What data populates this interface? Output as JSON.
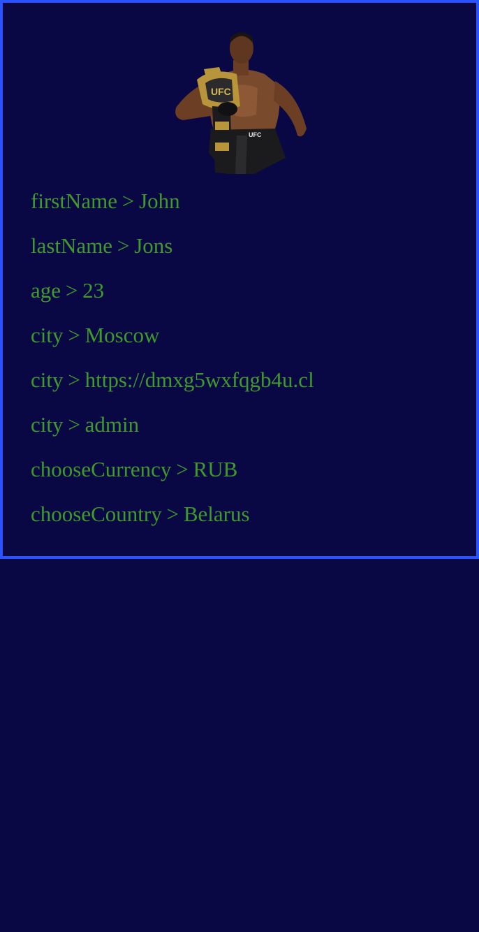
{
  "profile": {
    "avatar": "fighter-photo-with-championship-belt",
    "separator": ">",
    "fields": [
      {
        "key": "firstName",
        "value": "John"
      },
      {
        "key": "lastName",
        "value": "Jons"
      },
      {
        "key": "age",
        "value": "23"
      },
      {
        "key": "city",
        "value": "Moscow"
      },
      {
        "key": "city",
        "value": "https://dmxg5wxfqgb4u.cl"
      },
      {
        "key": "city",
        "value": "admin"
      },
      {
        "key": "chooseCurrency",
        "value": "RUB"
      },
      {
        "key": "chooseCountry",
        "value": "Belarus"
      }
    ]
  },
  "colors": {
    "background": "#0a0844",
    "border": "#2a52ff",
    "text": "#3f9a2c"
  }
}
